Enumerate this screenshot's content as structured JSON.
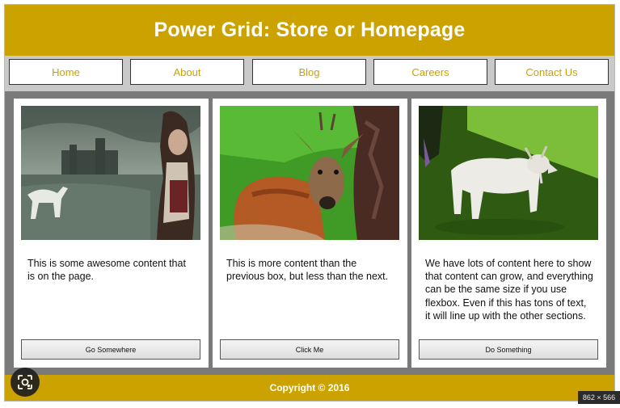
{
  "header": {
    "title": "Power Grid: Store or Homepage"
  },
  "nav": {
    "items": [
      {
        "label": "Home"
      },
      {
        "label": "About"
      },
      {
        "label": "Blog"
      },
      {
        "label": "Careers"
      },
      {
        "label": "Contact Us"
      }
    ]
  },
  "cards": [
    {
      "image": "castle-unicorn-girl-painting",
      "text": "This is some awesome content that is on the page.",
      "button": "Go Somewhere"
    },
    {
      "image": "deer-in-forest-photo",
      "text": "This is more content than the previous box, but less than the next.",
      "button": "Click Me"
    },
    {
      "image": "white-goat-on-grass-photo",
      "text": "We have lots of content here to show that content can grow, and everything can be the same size if you use flexbox. Even if this has tons of text, it will line up with the other sections.",
      "button": "Do Something"
    }
  ],
  "footer": {
    "text": "Copyright © 2016"
  },
  "overlay": {
    "lens_icon": "image-search-icon",
    "dimensions_badge": "862 × 566"
  },
  "colors": {
    "brand_gold": "#cba200",
    "nav_bg": "#c9c9c9",
    "content_bg": "#7a7a7a"
  }
}
